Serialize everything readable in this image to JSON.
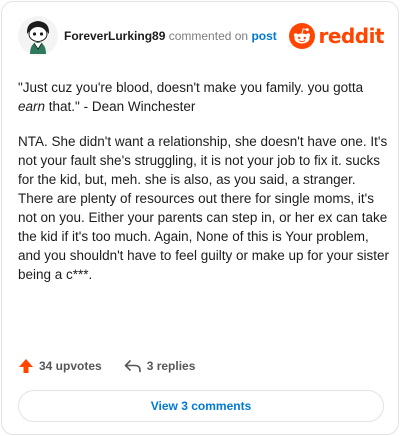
{
  "header": {
    "username": "ForeverLurking89",
    "action_text": "commented on",
    "post_link": "post",
    "brand": "reddit"
  },
  "comment": {
    "quote": {
      "before": "\"Just cuz you're blood, doesn't make you family. you gotta ",
      "emphasis": "earn",
      "after": " that.\" - Dean Winchester"
    },
    "body": "NTA. She didn't want a relationship, she doesn't have one. It's not your fault she's struggling, it is not your job to fix it. sucks for the kid, but, meh. she is also, as you said, a stranger. There are plenty of resources out there for single moms, it's not on you. Either your parents can step in, or her ex can take the kid if it's too much. Again, None of this is Your problem, and you shouldn't have to feel guilty or make up for your sister being a c***."
  },
  "footer": {
    "upvotes": "34 upvotes",
    "replies": "3 replies",
    "view_button": "View 3 comments"
  },
  "colors": {
    "brand": "#ff4500",
    "upvote": "#ff4500",
    "link": "#0079d3",
    "muted": "#7c7c7c"
  },
  "icons": {
    "avatar": "snoo-avatar",
    "brand": "reddit-logo-icon",
    "upvote": "upvote-arrow-icon",
    "reply": "reply-arrow-icon"
  }
}
